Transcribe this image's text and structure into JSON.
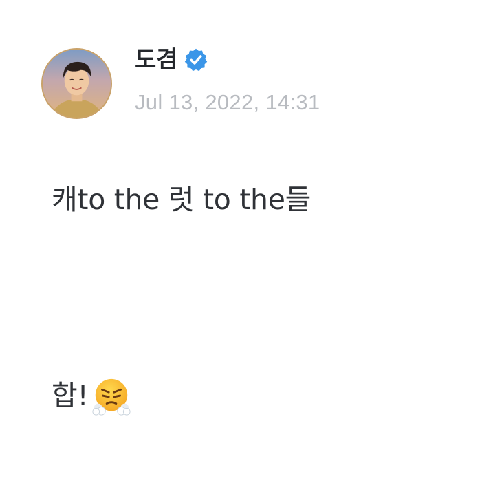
{
  "post": {
    "author": {
      "name": "도겸",
      "verified": true,
      "avatar_icon": "profile-photo"
    },
    "timestamp": "Jul 13, 2022, 14:31",
    "body": {
      "line1": "캐to the 럿 to the들",
      "line2": "합!",
      "line2_emoji": "face-with-steam-from-nose-emoji"
    }
  },
  "colors": {
    "verified_badge": "#3b96e8",
    "timestamp": "#b8bbc0",
    "text": "#2f3237"
  }
}
